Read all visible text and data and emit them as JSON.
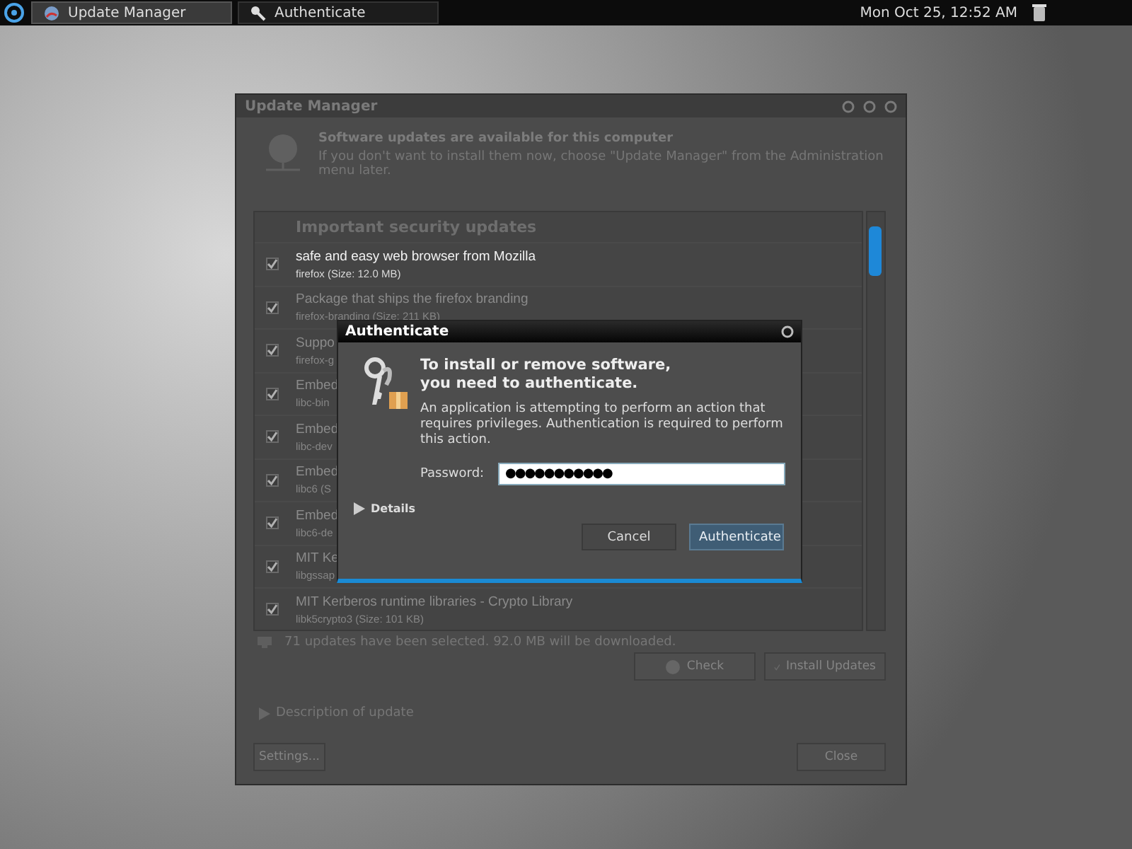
{
  "taskbar": {
    "tasks": [
      {
        "label": "Update Manager",
        "selected": true
      },
      {
        "label": "Authenticate",
        "selected": false
      }
    ],
    "clock": "Mon Oct 25, 12:52 AM"
  },
  "update_manager": {
    "title": "Update Manager",
    "heading": "Software updates are available for this computer",
    "subheading": "If you don't want to install them now, choose \"Update Manager\" from the Administration menu later.",
    "group": "Important security updates",
    "rows": [
      {
        "name": "safe and easy web browser from Mozilla",
        "detail": "firefox (Size: 12.0 MB)",
        "checked": true,
        "selected": true
      },
      {
        "name": "Package that ships the firefox branding",
        "detail": "firefox-branding (Size: 211 KB)",
        "checked": true,
        "selected": false
      },
      {
        "name": "Suppo",
        "detail": "firefox-g",
        "checked": true,
        "selected": false
      },
      {
        "name": "Embed",
        "detail": "libc-bin",
        "checked": true,
        "selected": false
      },
      {
        "name": "Embed",
        "detail": "libc-dev",
        "checked": true,
        "selected": false
      },
      {
        "name": "Embed",
        "detail": "libc6 (S",
        "checked": true,
        "selected": false
      },
      {
        "name": "Embed",
        "detail": "libc6-de",
        "checked": true,
        "selected": false
      },
      {
        "name": "MIT Ke",
        "detail": "libgssap",
        "checked": true,
        "selected": false
      },
      {
        "name": "MIT Kerberos runtime libraries - Crypto Library",
        "detail": "libk5crypto3 (Size: 101 KB)",
        "checked": true,
        "selected": false
      }
    ],
    "status": "71 updates have been selected. 92.0 MB will be downloaded.",
    "check_button": "Check",
    "install_button": "Install Updates",
    "expander": "Description of update",
    "settings_button": "Settings...",
    "close_button": "Close"
  },
  "dialog": {
    "title": "Authenticate",
    "heading_lines": [
      "To install or remove software,",
      "you need to authenticate."
    ],
    "body": "An application is attempting to perform an action that requires privileges. Authentication is required to perform this action.",
    "password_label": "Password:",
    "password_value": "●●●●●●●●●●●",
    "details": "Details",
    "cancel_button": "Cancel",
    "ok_button": "Authenticate"
  }
}
